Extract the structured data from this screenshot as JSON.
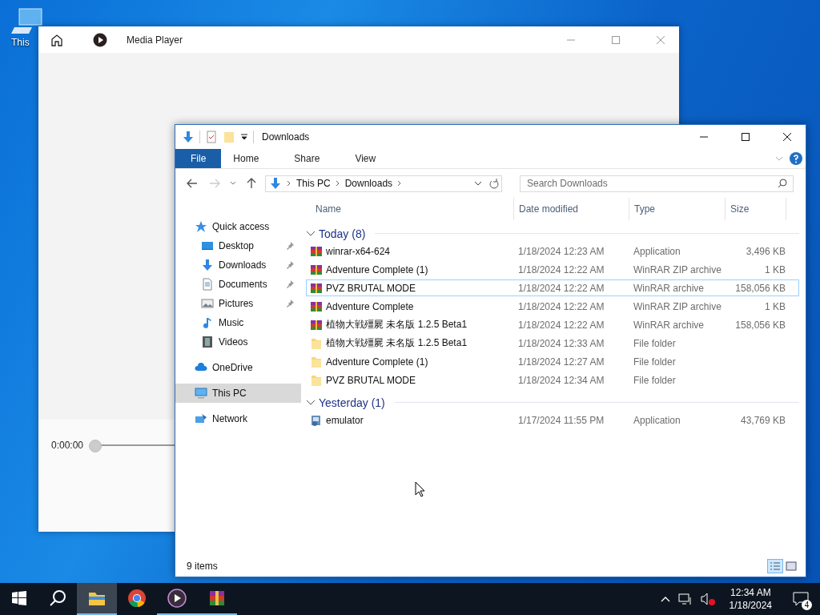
{
  "desktop_icons": [
    {
      "label": "This"
    }
  ],
  "media_player": {
    "title": "Media Player",
    "time": "0:00:00",
    "level": 0
  },
  "explorer": {
    "title": "Downloads",
    "ribbon_tabs": [
      {
        "label": "File",
        "selected": true
      },
      {
        "label": "Home",
        "selected": false
      },
      {
        "label": "Share",
        "selected": false
      },
      {
        "label": "View",
        "selected": false
      }
    ],
    "breadcrumb": [
      "This PC",
      "Downloads"
    ],
    "search": {
      "placeholder": "Search Downloads"
    },
    "nav": [
      {
        "label": "Quick access",
        "kind": "star",
        "selected": false,
        "children": [
          {
            "label": "Desktop",
            "kind": "desktop",
            "pinned": true,
            "selected": false
          },
          {
            "label": "Downloads",
            "kind": "download",
            "pinned": true,
            "selected": false
          },
          {
            "label": "Documents",
            "kind": "document",
            "pinned": true,
            "selected": false
          },
          {
            "label": "Pictures",
            "kind": "pictures",
            "pinned": true,
            "selected": false
          },
          {
            "label": "Music",
            "kind": "music",
            "pinned": false,
            "selected": false
          },
          {
            "label": "Videos",
            "kind": "videos",
            "pinned": false,
            "selected": false
          }
        ]
      },
      {
        "label": "OneDrive",
        "kind": "cloud",
        "selected": false
      },
      {
        "label": "This PC",
        "kind": "pc",
        "selected": true
      },
      {
        "label": "Network",
        "kind": "network",
        "selected": false
      }
    ],
    "columns": [
      "Name",
      "Date modified",
      "Type",
      "Size"
    ],
    "groups": [
      {
        "label": "Today (8)",
        "expanded": true,
        "rows": [
          {
            "name": "winrar-x64-624",
            "date": "1/18/2024 12:23 AM",
            "type": "Application",
            "size": "3,496 KB",
            "kind": "winrar",
            "selected": false
          },
          {
            "name": "Adventure Complete (1)",
            "date": "1/18/2024 12:22 AM",
            "type": "WinRAR ZIP archive",
            "size": "1 KB",
            "kind": "winrar",
            "selected": false
          },
          {
            "name": "PVZ BRUTAL MODE",
            "date": "1/18/2024 12:22 AM",
            "type": "WinRAR archive",
            "size": "158,056 KB",
            "kind": "winrar",
            "selected": true
          },
          {
            "name": "Adventure Complete",
            "date": "1/18/2024 12:22 AM",
            "type": "WinRAR ZIP archive",
            "size": "1 KB",
            "kind": "winrar",
            "selected": false
          },
          {
            "name": "植物大戦殭屍 未名版 1.2.5 Beta1",
            "date": "1/18/2024 12:22 AM",
            "type": "WinRAR archive",
            "size": "158,056 KB",
            "kind": "winrar",
            "selected": false
          },
          {
            "name": "植物大戦殭屍 未名版 1.2.5 Beta1",
            "date": "1/18/2024 12:33 AM",
            "type": "File folder",
            "kind": "folder",
            "selected": false
          },
          {
            "name": "Adventure Complete (1)",
            "date": "1/18/2024 12:27 AM",
            "type": "File folder",
            "kind": "folder",
            "selected": false
          },
          {
            "name": "PVZ BRUTAL MODE",
            "date": "1/18/2024 12:34 AM",
            "type": "File folder",
            "kind": "folder",
            "selected": false
          }
        ]
      },
      {
        "label": "Yesterday (1)",
        "expanded": true,
        "rows": [
          {
            "name": "emulator",
            "date": "1/17/2024 11:55 PM",
            "type": "Application",
            "size": "43,769 KB",
            "kind": "setup",
            "selected": false
          }
        ]
      }
    ],
    "status": "9 items",
    "views": [
      {
        "kind": "details",
        "selected": true
      },
      {
        "kind": "tiles",
        "selected": false
      }
    ]
  },
  "taskbar": {
    "apps": [
      {
        "kind": "explorer",
        "active": true,
        "running": true
      },
      {
        "kind": "chrome",
        "active": false,
        "running": false
      },
      {
        "kind": "player",
        "active": false,
        "running": true
      },
      {
        "kind": "winrar",
        "active": false,
        "running": true
      }
    ],
    "time": "12:34 AM",
    "date": "1/18/2024",
    "notifications": "4"
  }
}
